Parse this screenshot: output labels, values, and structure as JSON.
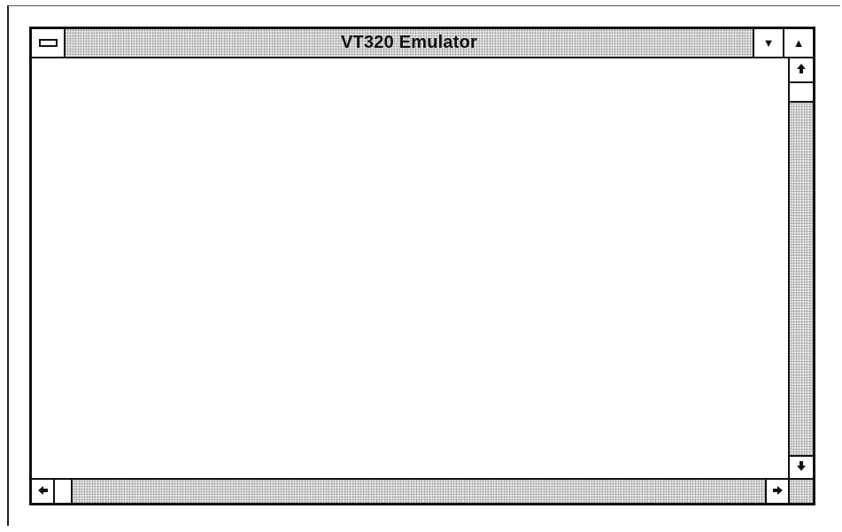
{
  "window": {
    "title": "VT320 Emulator"
  },
  "icons": {
    "system_menu": "system-menu-icon",
    "minimize": "triangle-down-icon",
    "maximize": "triangle-up-icon",
    "scroll_up": "arrow-up-icon",
    "scroll_down": "arrow-down-icon",
    "scroll_left": "arrow-left-icon",
    "scroll_right": "arrow-right-icon"
  },
  "glyphs": {
    "minimize": "▼",
    "maximize": "▲",
    "scroll_up": "🡅",
    "scroll_down": "🡇",
    "scroll_left": "🡄",
    "scroll_right": "🡆"
  }
}
